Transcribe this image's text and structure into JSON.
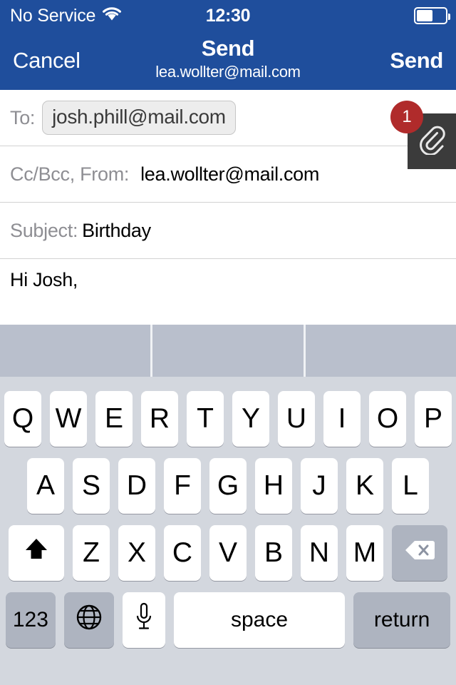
{
  "status_bar": {
    "carrier": "No Service",
    "wifi_icon": "wifi-icon",
    "time": "12:30",
    "battery_icon": "battery-icon",
    "battery_level_percent": 50
  },
  "nav_bar": {
    "cancel_label": "Cancel",
    "title": "Send",
    "subtitle": "lea.wollter@mail.com",
    "send_label": "Send",
    "background_color": "#1f4e9c"
  },
  "compose": {
    "to": {
      "label": "To:",
      "recipient": "josh.phill@mail.com"
    },
    "cc_bcc_from": {
      "label": "Cc/Bcc, From:",
      "value": "lea.wollter@mail.com"
    },
    "subject": {
      "label": "Subject:",
      "value": "Birthday"
    },
    "attachment": {
      "icon": "paperclip-icon",
      "badge_count": "1",
      "badge_color": "#b02b2b",
      "panel_color": "#3b3b3b"
    },
    "body": {
      "text": "Hi Josh,"
    }
  },
  "keyboard": {
    "suggestions": [
      "",
      "",
      ""
    ],
    "row1": [
      "Q",
      "W",
      "E",
      "R",
      "T",
      "Y",
      "U",
      "I",
      "O",
      "P"
    ],
    "row2": [
      "A",
      "S",
      "D",
      "F",
      "G",
      "H",
      "J",
      "K",
      "L"
    ],
    "row3": [
      "Z",
      "X",
      "C",
      "V",
      "B",
      "N",
      "M"
    ],
    "shift_icon": "shift-icon",
    "backspace_icon": "backspace-icon",
    "numbers_label": "123",
    "globe_icon": "globe-icon",
    "mic_icon": "microphone-icon",
    "space_label": "space",
    "return_label": "return",
    "background_color": "#d3d7de",
    "suggestion_bar_color": "#b9bfcc"
  }
}
